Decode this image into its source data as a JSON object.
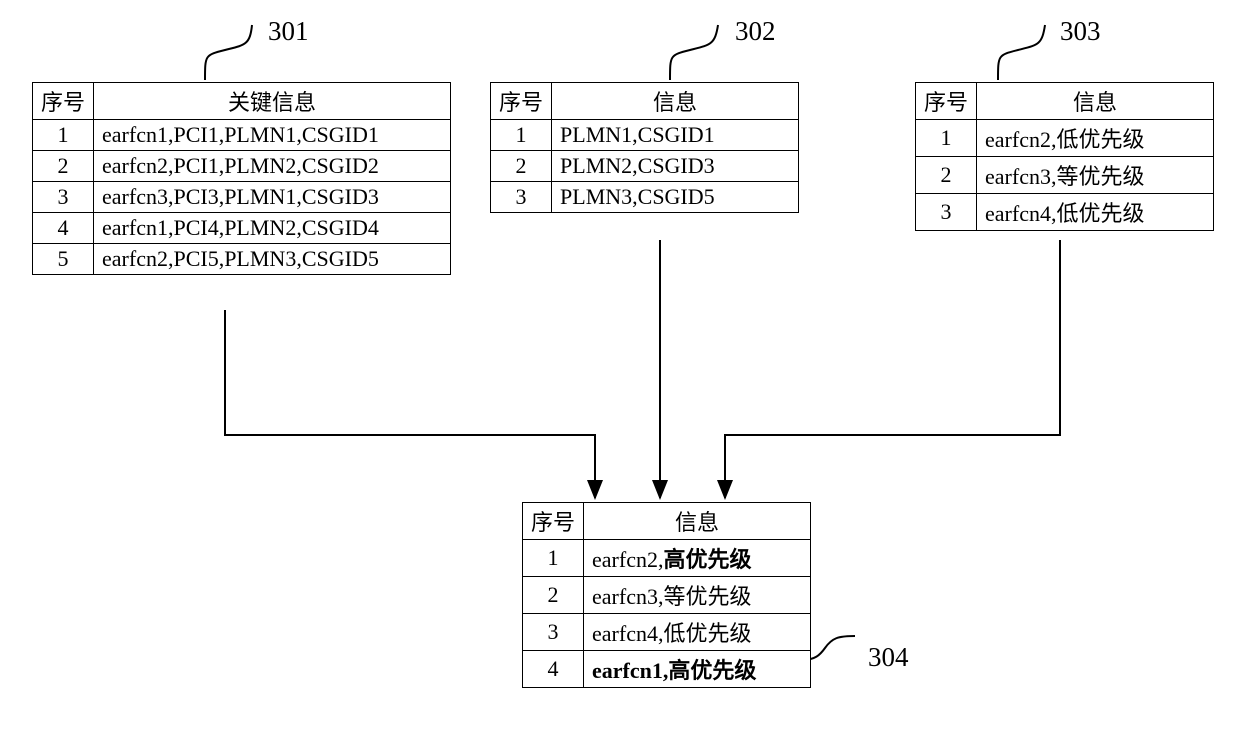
{
  "labels": {
    "t301": "301",
    "t302": "302",
    "t303": "303",
    "t304": "304"
  },
  "headers": {
    "seq": "序号",
    "keyinfo": "关键信息",
    "info": "信息"
  },
  "table301": {
    "rows": [
      {
        "n": "1",
        "v": "earfcn1,PCI1,PLMN1,CSGID1"
      },
      {
        "n": "2",
        "v": "earfcn2,PCI1,PLMN2,CSGID2"
      },
      {
        "n": "3",
        "v": "earfcn3,PCI3,PLMN1,CSGID3"
      },
      {
        "n": "4",
        "v": "earfcn1,PCI4,PLMN2,CSGID4"
      },
      {
        "n": "5",
        "v": "earfcn2,PCI5,PLMN3,CSGID5"
      }
    ]
  },
  "table302": {
    "rows": [
      {
        "n": "1",
        "v": "PLMN1,CSGID1"
      },
      {
        "n": "2",
        "v": "PLMN2,CSGID3"
      },
      {
        "n": "3",
        "v": "PLMN3,CSGID5"
      }
    ]
  },
  "table303": {
    "rows": [
      {
        "n": "1",
        "v": "earfcn2,低优先级"
      },
      {
        "n": "2",
        "v": "earfcn3,等优先级"
      },
      {
        "n": "3",
        "v": "earfcn4,低优先级"
      }
    ]
  },
  "table304": {
    "rows": [
      {
        "n": "1",
        "v_a": "earfcn2,",
        "v_b": "高优先级",
        "bold_all": false,
        "bold_b": true
      },
      {
        "n": "2",
        "v_a": "earfcn3,等优先级",
        "v_b": "",
        "bold_all": false,
        "bold_b": false
      },
      {
        "n": "3",
        "v_a": "earfcn4,低优先级",
        "v_b": "",
        "bold_all": false,
        "bold_b": false
      },
      {
        "n": "4",
        "v_a": "earfcn1,高优先级",
        "v_b": "",
        "bold_all": true,
        "bold_b": false
      }
    ]
  }
}
